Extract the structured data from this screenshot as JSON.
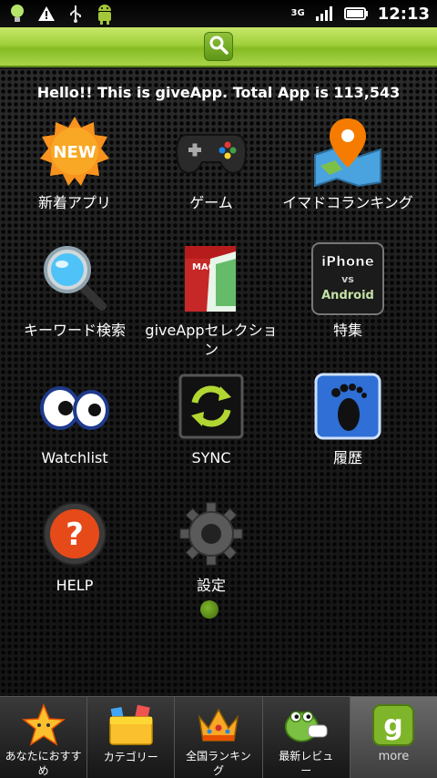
{
  "status_bar": {
    "network": "3G",
    "time": "12:13",
    "icons": [
      "lightbulb-icon",
      "warning-icon",
      "usb-icon",
      "android-icon",
      "signal-icon",
      "battery-icon"
    ]
  },
  "header": {
    "icon": "search-icon"
  },
  "banner": "Hello!! This is giveApp. Total App is 113,543",
  "grid": [
    {
      "label": "新着アプリ",
      "icon": "new-badge-icon"
    },
    {
      "label": "ゲーム",
      "icon": "gamepad-icon"
    },
    {
      "label": "イマドコランキング",
      "icon": "map-pin-icon"
    },
    {
      "label": "キーワード検索",
      "icon": "magnifier-icon"
    },
    {
      "label": "giveAppセレクション",
      "icon": "magazine-icon"
    },
    {
      "label": "特集",
      "icon": "iphone-vs-android-icon",
      "art_text": "iPhone vs Android"
    },
    {
      "label": "Watchlist",
      "icon": "eyes-icon"
    },
    {
      "label": "SYNC",
      "icon": "sync-icon"
    },
    {
      "label": "履歴",
      "icon": "footprint-icon"
    },
    {
      "label": "HELP",
      "icon": "help-icon"
    },
    {
      "label": "設定",
      "icon": "settings-gear-icon"
    }
  ],
  "tabs": [
    {
      "label": "あなたにおすすめ",
      "icon": "star-icon"
    },
    {
      "label": "カテゴリー",
      "icon": "folder-icon"
    },
    {
      "label": "全国ランキング",
      "icon": "crown-icon"
    },
    {
      "label": "最新レビュー",
      "icon": "frog-chat-icon"
    },
    {
      "label": "more",
      "icon": "g-logo-icon",
      "active": true
    }
  ],
  "colors": {
    "accent_green": "#9fd03a",
    "text": "#ffffff",
    "background": "#1a1a1a"
  }
}
